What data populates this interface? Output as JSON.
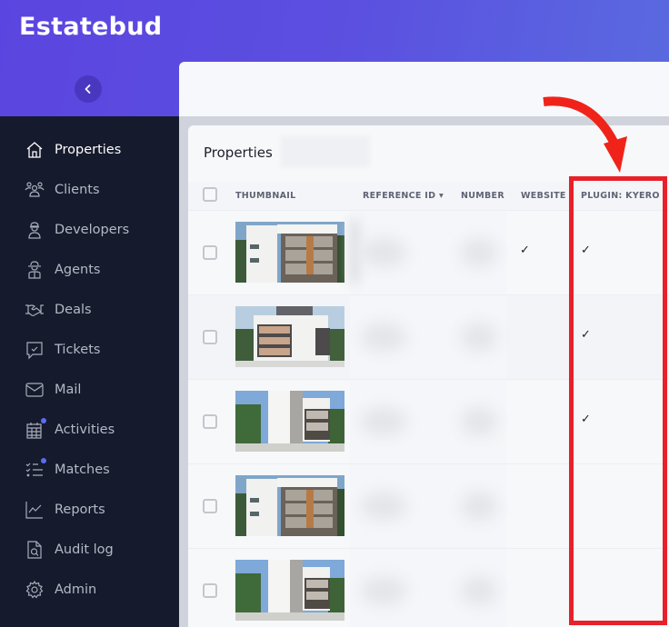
{
  "app": {
    "brand": "Estatebud",
    "collapse_icon": "chevron-left-icon"
  },
  "sidebar": {
    "items": [
      {
        "label": "Properties",
        "icon": "home-icon",
        "active": true
      },
      {
        "label": "Clients",
        "icon": "users-icon"
      },
      {
        "label": "Developers",
        "icon": "builder-icon"
      },
      {
        "label": "Agents",
        "icon": "agent-icon"
      },
      {
        "label": "Deals",
        "icon": "handshake-icon"
      },
      {
        "label": "Tickets",
        "icon": "ticket-chat-icon"
      },
      {
        "label": "Mail",
        "icon": "mail-icon"
      },
      {
        "label": "Activities",
        "icon": "calendar-icon",
        "badge_dot": true
      },
      {
        "label": "Matches",
        "icon": "checklist-icon",
        "badge_dot": true
      },
      {
        "label": "Reports",
        "icon": "chart-icon"
      },
      {
        "label": "Audit log",
        "icon": "file-search-icon"
      },
      {
        "label": "Admin",
        "icon": "gear-icon"
      }
    ],
    "badge_color": "#5b6cf0"
  },
  "properties": {
    "title": "Properties",
    "columns": {
      "thumbnail": "THUMBNAIL",
      "reference_id": "REFERENCE ID",
      "number": "NUMBER",
      "website": "WEBSITE",
      "plugin_kyero": "PLUGIN: KYERO"
    },
    "sort_indicator": "▾",
    "rows": [
      {
        "website": "✓",
        "plugin_kyero": "✓",
        "thumbnail": "building-photo-a"
      },
      {
        "website": "",
        "plugin_kyero": "✓",
        "thumbnail": "building-photo-b"
      },
      {
        "website": "",
        "plugin_kyero": "✓",
        "thumbnail": "building-photo-c"
      },
      {
        "website": "",
        "plugin_kyero": "",
        "thumbnail": "building-photo-a"
      },
      {
        "website": "",
        "plugin_kyero": "",
        "thumbnail": "building-photo-c"
      }
    ]
  },
  "annotation": {
    "highlight_color": "#e8202a",
    "highlighted_column": "PLUGIN: KYERO"
  }
}
